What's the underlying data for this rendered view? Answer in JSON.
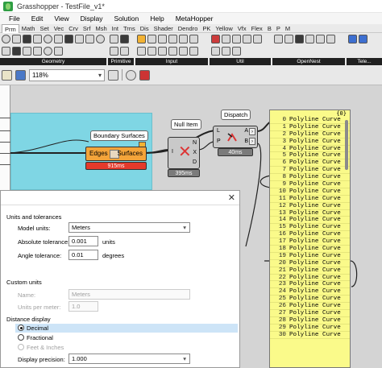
{
  "window": {
    "title": "Grasshopper - TestFile_v1*"
  },
  "menubar": {
    "items": [
      "File",
      "Edit",
      "View",
      "Display",
      "Solution",
      "Help",
      "MetaHopper"
    ]
  },
  "tabs": [
    "Prm",
    "Math",
    "Set",
    "Vec",
    "Crv",
    "Srf",
    "Msh",
    "Int",
    "Trns",
    "Dis",
    "Shader",
    "Dendro",
    "PK",
    "Yellow",
    "Vfx",
    "Flex",
    "B",
    "P",
    "M"
  ],
  "ribbon": {
    "groups": [
      "Geometry",
      "Primitive",
      "Input",
      "Util",
      "OpenNest",
      "Tele..."
    ]
  },
  "canvas_toolbar": {
    "zoom": "118%"
  },
  "canvas": {
    "group_label": "Boundary Surfaces",
    "boundary": {
      "input": "Edges",
      "output": "Surfaces",
      "time": "915ms"
    },
    "null_item": {
      "label": "Null Item",
      "inputs": [
        "I"
      ],
      "outputs": [
        "N",
        "X",
        "D"
      ],
      "time": "395ms"
    },
    "dispatch": {
      "label": "Dispatch",
      "inputs": [
        "L",
        "P"
      ],
      "outputs": [
        "A",
        "B"
      ],
      "time": "40ms"
    }
  },
  "panel": {
    "header": "{0}",
    "rows": [
      {
        "i": "0",
        "t": "Polyline Curve"
      },
      {
        "i": "1",
        "t": "Polyline Curve"
      },
      {
        "i": "2",
        "t": "Polyline Curve"
      },
      {
        "i": "3",
        "t": "Polyline Curve"
      },
      {
        "i": "4",
        "t": "Polyline Curve"
      },
      {
        "i": "5",
        "t": "Polyline Curve"
      },
      {
        "i": "6",
        "t": "Polyline Curve"
      },
      {
        "i": "7",
        "t": "Polyline Curve"
      },
      {
        "i": "8",
        "t": "Polyline Curve"
      },
      {
        "i": "9",
        "t": "Polyline Curve"
      },
      {
        "i": "10",
        "t": "Polyline Curve"
      },
      {
        "i": "11",
        "t": "Polyline Curve"
      },
      {
        "i": "12",
        "t": "Polyline Curve"
      },
      {
        "i": "13",
        "t": "Polyline Curve"
      },
      {
        "i": "14",
        "t": "Polyline Curve"
      },
      {
        "i": "15",
        "t": "Polyline Curve"
      },
      {
        "i": "16",
        "t": "Polyline Curve"
      },
      {
        "i": "17",
        "t": "Polyline Curve"
      },
      {
        "i": "18",
        "t": "Polyline Curve"
      },
      {
        "i": "19",
        "t": "Polyline Curve"
      },
      {
        "i": "20",
        "t": "Polyline Curve"
      },
      {
        "i": "21",
        "t": "Polyline Curve"
      },
      {
        "i": "22",
        "t": "Polyline Curve"
      },
      {
        "i": "23",
        "t": "Polyline Curve"
      },
      {
        "i": "24",
        "t": "Polyline Curve"
      },
      {
        "i": "25",
        "t": "Polyline Curve"
      },
      {
        "i": "26",
        "t": "Polyline Curve"
      },
      {
        "i": "27",
        "t": "Polyline Curve"
      },
      {
        "i": "28",
        "t": "Polyline Curve"
      },
      {
        "i": "29",
        "t": "Polyline Curve"
      },
      {
        "i": "30",
        "t": "Polyline Curve"
      }
    ]
  },
  "dialog": {
    "units_section": "Units and tolerances",
    "model_units_label": "Model units:",
    "model_units_value": "Meters",
    "abs_tol_label": "Absolute tolerance:",
    "abs_tol_value": "0.001",
    "abs_tol_unit": "units",
    "angle_tol_label": "Angle tolerance:",
    "angle_tol_value": "0.01",
    "angle_tol_unit": "degrees",
    "custom_section": "Custom units",
    "name_label": "Name:",
    "name_value": "Meters",
    "upm_label": "Units per meter:",
    "upm_value": "1.0",
    "distance_section": "Distance display",
    "radio_decimal": "Decimal",
    "radio_fractional": "Fractional",
    "radio_feet": "Feet & Inches",
    "precision_label": "Display precision:",
    "precision_value": "1.000"
  }
}
